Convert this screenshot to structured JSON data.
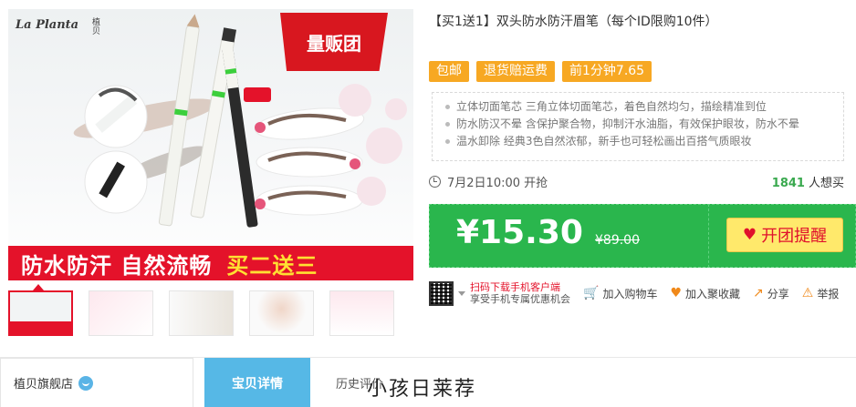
{
  "product_image": {
    "brand": "La Planta",
    "brand_cn": "植贝",
    "ribbon": "量贩团",
    "banner_left": "防水防汗  自然流畅",
    "banner_right": "买二送三"
  },
  "thumbnails": [
    {
      "name": "thumb-1"
    },
    {
      "name": "thumb-2"
    },
    {
      "name": "thumb-3"
    },
    {
      "name": "thumb-4"
    },
    {
      "name": "thumb-5"
    }
  ],
  "title": "【买1送1】双头防水防汗眉笔（每个ID限购10件）",
  "tags": [
    "包邮",
    "退货赔运费",
    "前1分钟7.65"
  ],
  "features": [
    "立体切面笔芯 三角立体切面笔芯，着色自然均匀，描绘精准到位",
    "防水防汉不晕 含保护聚合物，抑制汗水油脂，有效保护眼妆，防水不晕",
    "温水卸除 经典3色自然浓郁，新手也可轻松画出百搭气质眼妆"
  ],
  "schedule": {
    "time": "7月2日10:00 开抢",
    "want_count": "1841",
    "want_label": "人想买"
  },
  "price": {
    "current": "¥15.30",
    "original": "¥89.00",
    "button": "开团提醒"
  },
  "actions": {
    "qr_line1": "扫码下载手机客户端",
    "qr_line2": "享受手机专属优惠机会",
    "cart": "加入购物车",
    "favorite": "加入聚收藏",
    "share": "分享",
    "report": "举报"
  },
  "bottom": {
    "store": "植贝旗舰店",
    "tab_active": "宝贝详情",
    "tab2": "历史评价",
    "watermark": "小孩日莱荐"
  },
  "colors": {
    "brand_red": "#e4122a",
    "tag_orange": "#f7a823",
    "price_green": "#2ab64d",
    "tab_blue": "#56b8e6"
  }
}
